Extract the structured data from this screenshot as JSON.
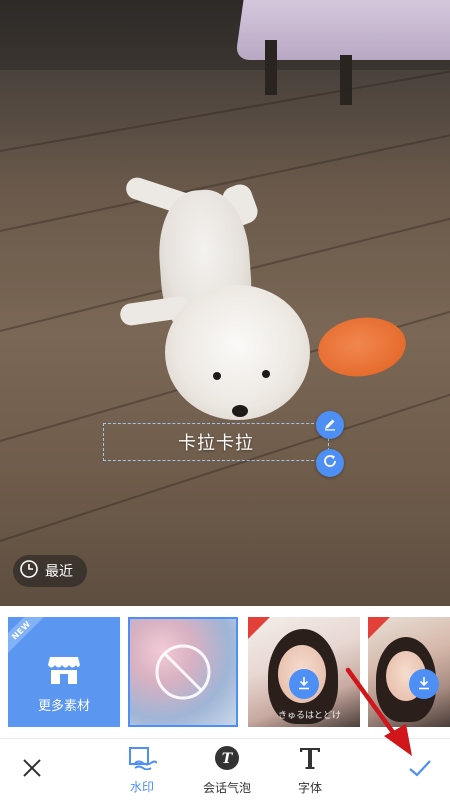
{
  "photo": {
    "watermark_text": "卡拉卡拉",
    "recent_label": "最近"
  },
  "materials": {
    "new_badge": "NEW",
    "more_label": "更多素材",
    "tile1_caption": "きゅるはとどけ"
  },
  "toolbar": {
    "watermark_label": "水印",
    "bubble_label": "会话气泡",
    "font_label": "字体"
  },
  "colors": {
    "accent": "#4d8ff5",
    "annotation_arrow": "#d0151b"
  },
  "icons": {
    "edit": "pencil-icon",
    "rotate": "rotate-icon",
    "recent": "clock-icon",
    "store": "store-icon",
    "none": "prohibited-icon",
    "download": "download-icon",
    "close": "close-icon",
    "watermark": "watermark-icon",
    "bubble": "speech-bubble-icon",
    "font": "font-icon",
    "confirm": "checkmark-icon"
  }
}
